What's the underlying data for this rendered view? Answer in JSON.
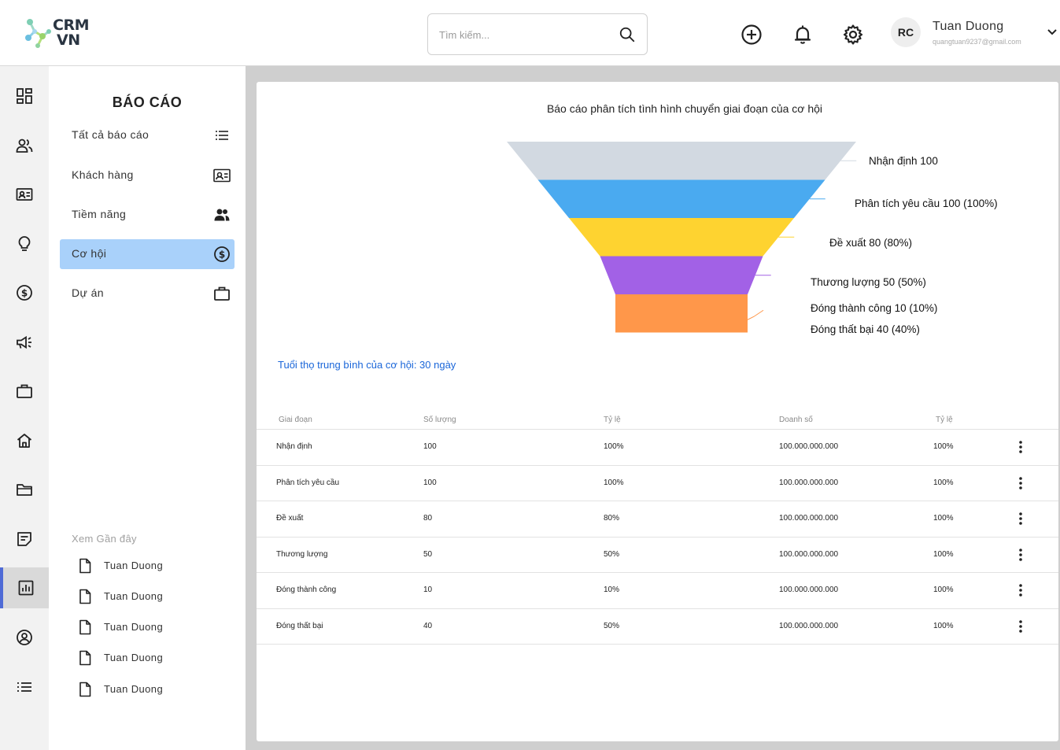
{
  "brand": {
    "line1": "CRM",
    "line2": "VN"
  },
  "search": {
    "placeholder": "Tìm kiếm..."
  },
  "header_icons": [
    "add-circle-icon",
    "bell-icon",
    "gear-icon"
  ],
  "user": {
    "initials": "RC",
    "name": "Tuan Duong",
    "email": "quangtuan9237@gmail.com"
  },
  "rail": [
    "dashboard-icon",
    "users-icon",
    "contact-card-icon",
    "lightbulb-icon",
    "dollar-icon",
    "megaphone-icon",
    "briefcase-icon",
    "home-icon",
    "folder-icon",
    "note-icon",
    "chart-icon",
    "user-circle-icon",
    "list-icon"
  ],
  "panel": {
    "title": "BÁO CÁO",
    "items": [
      {
        "label": "Tất cả báo cáo",
        "icon": "list-icon"
      },
      {
        "label": "Khách hàng",
        "icon": "contact-card-icon"
      },
      {
        "label": "Tiềm năng",
        "icon": "users-icon"
      },
      {
        "label": "Cơ hội",
        "icon": "dollar-icon",
        "active": true
      },
      {
        "label": "Dự án",
        "icon": "briefcase-icon"
      }
    ],
    "recent_title": "Xem Gần đây",
    "recent": [
      "Tuan Duong",
      "Tuan Duong",
      "Tuan Duong",
      "Tuan Duong",
      "Tuan Duong"
    ]
  },
  "chart_data": {
    "type": "funnel",
    "title": "Báo cáo phân tích tình hình chuyển giai đoạn của cơ hội",
    "stages": [
      {
        "label": "Nhận định 100",
        "value": 100,
        "color": "#d2d9e1"
      },
      {
        "label": "Phân tích yêu cầu 100 (100%)",
        "value": 100,
        "color": "#4aaaf0"
      },
      {
        "label": "Đề xuất 80 (80%)",
        "value": 80,
        "color": "#fed330"
      },
      {
        "label": "Thương lượng 50 (50%)",
        "value": 50,
        "color": "#a261e6"
      },
      {
        "label": "Đóng thành công 10 (10%)",
        "value": 10,
        "color": "#ff974a"
      },
      {
        "label": "Đóng thất bại 40 (40%)",
        "value": 40,
        "color": "#ff974a"
      }
    ]
  },
  "avg_life": "Tuổi thọ trung bình của cơ hội: 30 ngày",
  "table": {
    "headers": [
      "Giai đoạn",
      "Số lượng",
      "Tỷ lệ",
      "Doanh số",
      "Tỷ lệ"
    ],
    "rows": [
      [
        "Nhận định",
        "100",
        "100%",
        "100.000.000.000",
        "100%"
      ],
      [
        "Phân tích yêu cầu",
        "100",
        "100%",
        "100.000.000.000",
        "100%"
      ],
      [
        "Đề xuất",
        "80",
        "80%",
        "100.000.000.000",
        "100%"
      ],
      [
        "Thương lượng",
        "50",
        "50%",
        "100.000.000.000",
        "100%"
      ],
      [
        "Đóng thành công",
        "10",
        "10%",
        "100.000.000.000",
        "100%"
      ],
      [
        "Đóng thất bại",
        "40",
        "50%",
        "100.000.000.000",
        "100%"
      ]
    ]
  }
}
